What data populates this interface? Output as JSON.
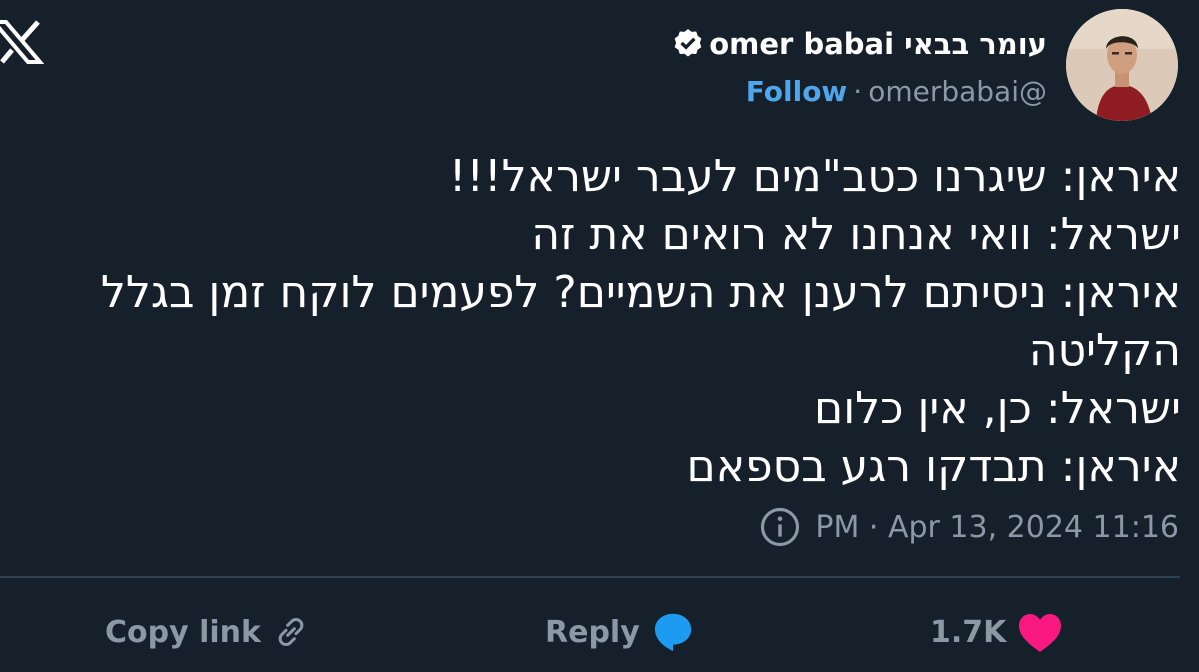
{
  "header": {
    "display_name": "עומר בבאי omer babai",
    "follow_label": "Follow",
    "handle": "omerbabai@",
    "separator": "·"
  },
  "tweet": {
    "lines": [
      "איראן: שיגרנו כטב\"מים לעבר ישראל!!!",
      "ישראל: וואי אנחנו לא רואים את זה",
      "איראן: ניסיתם לרענן את השמיים? לפעמים לוקח זמן בגלל",
      "הקליטה",
      "ישראל: כן, אין כלום",
      "איראן: תבדקו רגע בספאם"
    ],
    "timestamp": "PM · Apr 13, 2024 11:16"
  },
  "actions": {
    "copy_link": "Copy link",
    "reply": "Reply",
    "likes": "1.7K"
  },
  "icons": {
    "logo": "x-logo-icon",
    "verified": "verified-badge-icon",
    "info": "info-icon",
    "link": "link-icon",
    "reply": "reply-bubble-icon",
    "like": "heart-icon"
  },
  "colors": {
    "background": "#15202b",
    "accent": "#4fa6ec",
    "reply_icon": "#1d9bf0",
    "like_icon": "#f91880",
    "muted": "#8b98a5",
    "text": "#ffffff"
  }
}
